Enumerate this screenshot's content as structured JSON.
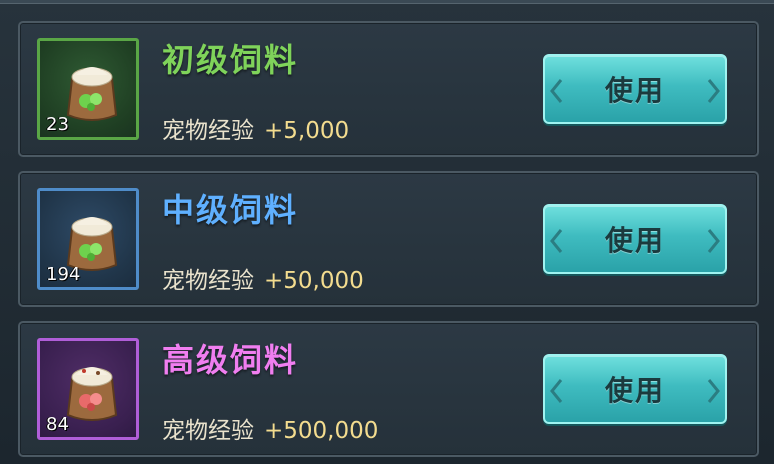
{
  "items": [
    {
      "name": "初级饲料",
      "count": "23",
      "exp_label": "宠物经验",
      "exp_value": "+5,000",
      "button_label": "使用",
      "rarity_color": "#5aa646"
    },
    {
      "name": "中级饲料",
      "count": "194",
      "exp_label": "宠物经验",
      "exp_value": "+50,000",
      "button_label": "使用",
      "rarity_color": "#4f8cc9"
    },
    {
      "name": "高级饲料",
      "count": "84",
      "exp_label": "宠物经验",
      "exp_value": "+500,000",
      "button_label": "使用",
      "rarity_color": "#b05ed8"
    }
  ],
  "icons": {
    "item_icon": "feed-bag-icon",
    "chevron_left": "chevron-left-icon",
    "chevron_right": "chevron-right-icon"
  }
}
